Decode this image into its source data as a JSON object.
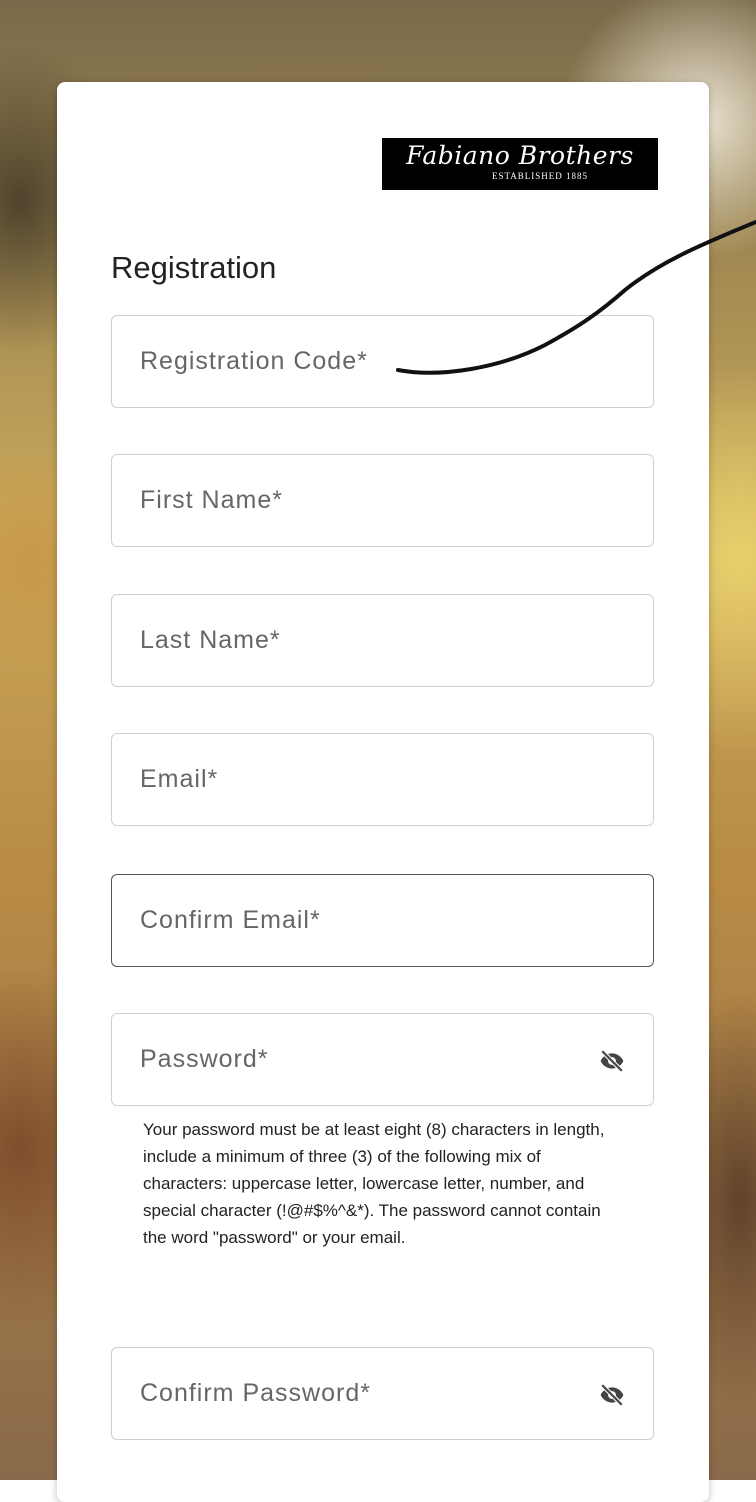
{
  "logo": {
    "name": "Fabiano Brothers",
    "tagline": "ESTABLISHED 1885"
  },
  "form": {
    "title": "Registration",
    "fields": {
      "registration_code": "Registration Code*",
      "first_name": "First Name*",
      "last_name": "Last Name*",
      "email": "Email*",
      "confirm_email": "Confirm Email*",
      "password": "Password*",
      "confirm_password": "Confirm Password*"
    },
    "password_hint": "Your password must be at least eight (8) characters in length, include a minimum of three (3) of the following mix of characters: uppercase letter, lowercase letter, number, and special character (!@#$%^&*). The password cannot contain the word \"password\" or your email."
  },
  "icons": {
    "visibility_toggle": "eye-off-icon"
  }
}
